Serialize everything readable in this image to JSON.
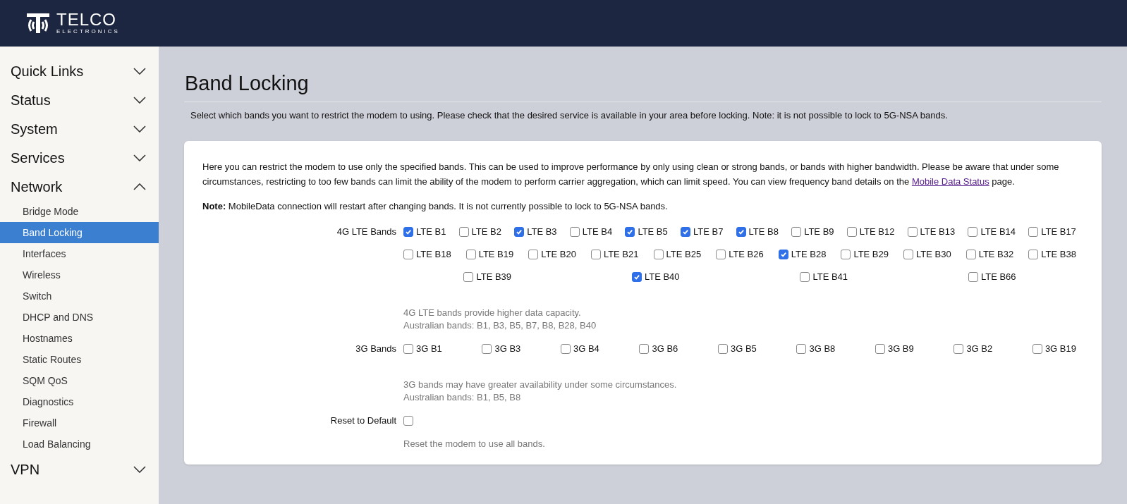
{
  "logo": {
    "name": "TELCO",
    "tagline": "ELECTRONICS"
  },
  "sidebar": {
    "items": [
      {
        "label": "Quick Links",
        "expanded": false
      },
      {
        "label": "Status",
        "expanded": false
      },
      {
        "label": "System",
        "expanded": false
      },
      {
        "label": "Services",
        "expanded": false
      },
      {
        "label": "Network",
        "expanded": true,
        "children": [
          {
            "label": "Bridge Mode",
            "selected": false
          },
          {
            "label": "Band Locking",
            "selected": true
          },
          {
            "label": "Interfaces",
            "selected": false
          },
          {
            "label": "Wireless",
            "selected": false
          },
          {
            "label": "Switch",
            "selected": false
          },
          {
            "label": "DHCP and DNS",
            "selected": false
          },
          {
            "label": "Hostnames",
            "selected": false
          },
          {
            "label": "Static Routes",
            "selected": false
          },
          {
            "label": "SQM QoS",
            "selected": false
          },
          {
            "label": "Diagnostics",
            "selected": false
          },
          {
            "label": "Firewall",
            "selected": false
          },
          {
            "label": "Load Balancing",
            "selected": false
          }
        ]
      },
      {
        "label": "VPN",
        "expanded": false
      }
    ]
  },
  "page": {
    "title": "Band Locking",
    "description": "Select which bands you want to restrict the modem to using. Please check that the desired service is available in your area before locking. Note: it is not possible to lock to 5G-NSA bands."
  },
  "card": {
    "intro_before_link": "Here you can restrict the modem to use only the specified bands. This can be used to improve performance by only using clean or strong bands, or bands with higher bandwidth. Please be aware that under some circumstances, restricting to too few bands can limit the ability of the modem to perform carrier aggregation, which can limit speed. You can view frequency band details on the",
    "intro_link": "Mobile Data Status",
    "intro_after_link": "page.",
    "note": "**Note:** MobileData connection will restart after changing bands. It is not currently possible to lock to 5G-NSA bands.",
    "lte": {
      "label": "4G LTE Bands",
      "bands": [
        {
          "label": "LTE B1",
          "checked": true
        },
        {
          "label": "LTE B2",
          "checked": false
        },
        {
          "label": "LTE B3",
          "checked": true
        },
        {
          "label": "LTE B4",
          "checked": false
        },
        {
          "label": "LTE B5",
          "checked": true
        },
        {
          "label": "LTE B7",
          "checked": true
        },
        {
          "label": "LTE B8",
          "checked": true
        },
        {
          "label": "LTE B9",
          "checked": false
        },
        {
          "label": "LTE B12",
          "checked": false
        },
        {
          "label": "LTE B13",
          "checked": false
        },
        {
          "label": "LTE B14",
          "checked": false
        },
        {
          "label": "LTE B17",
          "checked": false
        },
        {
          "label": "LTE B18",
          "checked": false
        },
        {
          "label": "LTE B19",
          "checked": false
        },
        {
          "label": "LTE B20",
          "checked": false
        },
        {
          "label": "LTE B21",
          "checked": false
        },
        {
          "label": "LTE B25",
          "checked": false
        },
        {
          "label": "LTE B26",
          "checked": false
        },
        {
          "label": "LTE B28",
          "checked": true
        },
        {
          "label": "LTE B29",
          "checked": false
        },
        {
          "label": "LTE B30",
          "checked": false
        },
        {
          "label": "LTE B32",
          "checked": false
        },
        {
          "label": "LTE B38",
          "checked": false
        },
        {
          "label": "LTE B39",
          "checked": false
        },
        {
          "label": "LTE B40",
          "checked": true
        },
        {
          "label": "LTE B41",
          "checked": false
        },
        {
          "label": "LTE B66",
          "checked": false
        }
      ],
      "help": [
        "4G LTE bands provide higher data capacity.",
        "Australian bands: B1, B3, B5, B7, B8, B28, B40"
      ]
    },
    "umts": {
      "label": "3G Bands",
      "bands": [
        {
          "label": "3G B1",
          "checked": false
        },
        {
          "label": "3G B3",
          "checked": false
        },
        {
          "label": "3G B4",
          "checked": false
        },
        {
          "label": "3G B6",
          "checked": false
        },
        {
          "label": "3G B5",
          "checked": false
        },
        {
          "label": "3G B8",
          "checked": false
        },
        {
          "label": "3G B9",
          "checked": false
        },
        {
          "label": "3G B2",
          "checked": false
        },
        {
          "label": "3G B19",
          "checked": false
        }
      ],
      "help": [
        "3G bands may have greater availability under some circumstances.",
        "Australian bands: B1, B5, B8"
      ]
    },
    "reset": {
      "label": "Reset to Default",
      "checked": false,
      "help": "Reset the modem to use all bands."
    }
  }
}
